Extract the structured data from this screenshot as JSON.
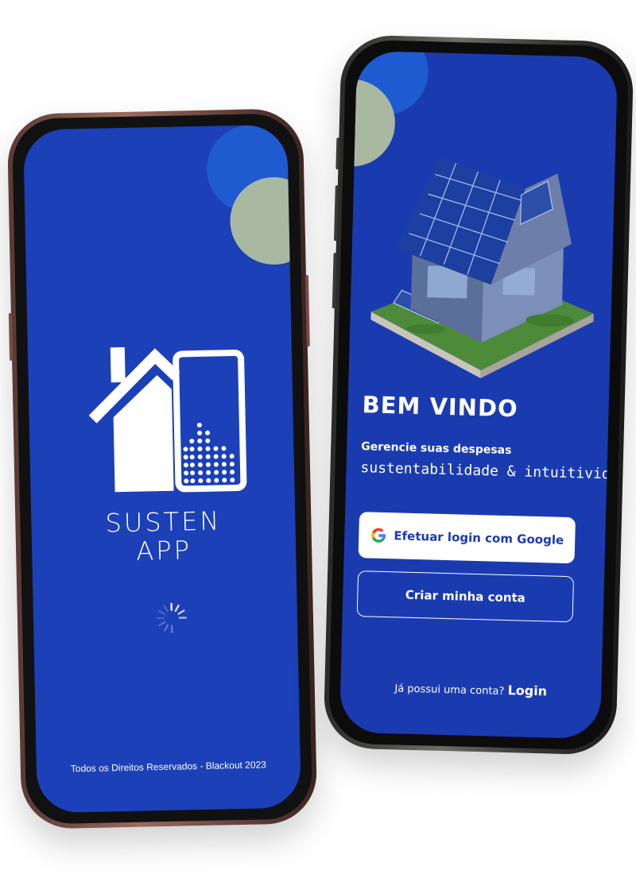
{
  "splash_screen": {
    "brand_line1": "SUSTEN",
    "brand_line2": "APP",
    "footer": "Todos os Direitos Reservados - Blackout 2023",
    "loading_indicator": "spinner-icon"
  },
  "welcome_screen": {
    "title": "BEM VINDO",
    "subtitle": "Gerencie suas despesas",
    "tagline": "sustentabilidade & intuitividade",
    "google_button_label": "Efetuar login com Google",
    "create_account_label": "Criar minha conta",
    "login_prompt": "Já possui uma conta?",
    "login_link": "Login",
    "illustration": "solar-house-image"
  },
  "colors": {
    "screen_background": "#1b40b7",
    "circle_blue": "#1e5ad0",
    "circle_sage": "#a9b8a0",
    "button_white": "#ffffff",
    "google_blue": "#4285F4",
    "google_red": "#EA4335",
    "google_yellow": "#FBBC05",
    "google_green": "#34A853"
  }
}
